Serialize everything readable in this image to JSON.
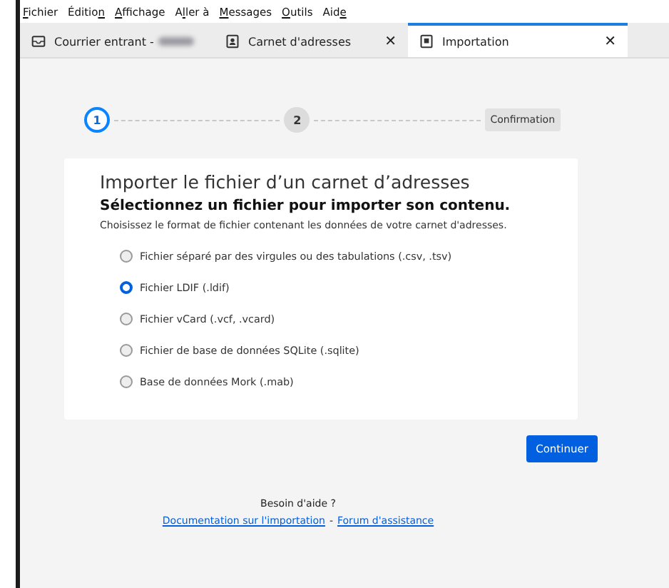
{
  "menu": [
    {
      "key": "F",
      "after": "ichier"
    },
    {
      "before": "Éditio",
      "key": "n"
    },
    {
      "key": "A",
      "after": "ffichage"
    },
    {
      "before": "A",
      "key": "l",
      "after": "ler à"
    },
    {
      "key": "M",
      "after": "essages"
    },
    {
      "key": "O",
      "after": "utils"
    },
    {
      "before": "Aid",
      "key": "e"
    }
  ],
  "tabs": [
    {
      "kind": "mail",
      "label": "Courrier entrant -",
      "redacted": true,
      "selected": false
    },
    {
      "kind": "contacts",
      "label": "Carnet d'adresses",
      "redacted": false,
      "close": "✕",
      "selected": false
    },
    {
      "kind": "import",
      "label": "Importation",
      "redacted": false,
      "close": "✕",
      "selected": true
    }
  ],
  "steps": [
    {
      "label": "1",
      "kind": "number",
      "selected": true
    },
    {
      "label": "2",
      "kind": "number",
      "selected": false
    },
    {
      "label": "Confirmation",
      "kind": "text",
      "selected": false
    }
  ],
  "card": {
    "title": "Importer le fichier d’un carnet d’adresses",
    "subtitle": "Sélectionnez un fichier pour importer son contenu.",
    "description": "Choisissez le format de fichier contenant les données de votre carnet d'adresses.",
    "options": [
      {
        "label": "Fichier séparé par des virgules ou des tabulations (.csv, .tsv)",
        "selected": false
      },
      {
        "label": "Fichier LDIF (.ldif)",
        "selected": true
      },
      {
        "label": "Fichier vCard (.vcf, .vcard)",
        "selected": false
      },
      {
        "label": "Fichier de base de données SQLite (.sqlite)",
        "selected": false
      },
      {
        "label": "Base de données Mork (.mab)",
        "selected": false
      }
    ]
  },
  "continue_button": "Continuer",
  "help": {
    "title": "Besoin d'aide ?",
    "links": [
      "Documentation sur l'importation",
      "Forum d'assistance"
    ],
    "separator": "-"
  }
}
